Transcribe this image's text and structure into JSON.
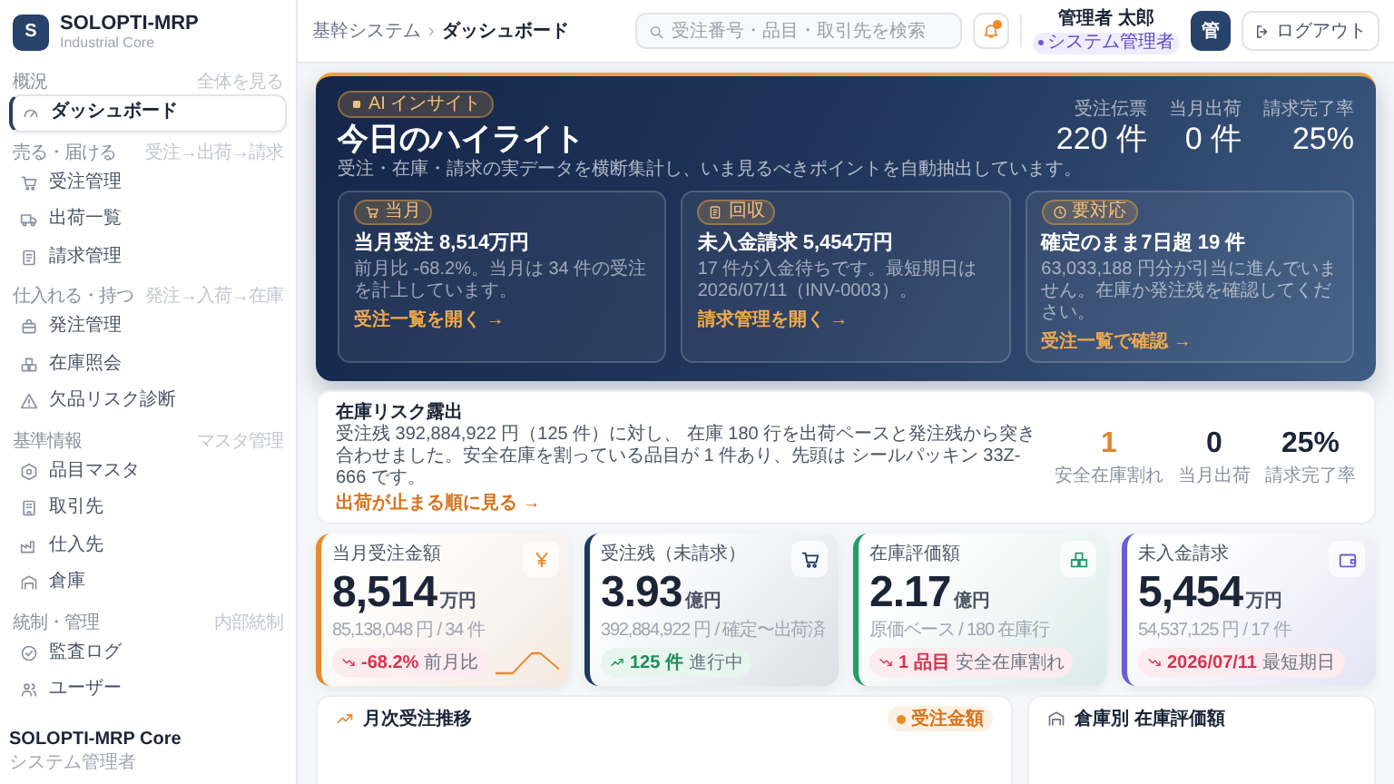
{
  "sidebar": {
    "brand": {
      "logo": "S",
      "name": "SOLOPTI-MRP",
      "subtitle": "Industrial Core"
    },
    "sections": [
      {
        "title": "概況",
        "hint": "全体を見る",
        "items": [
          {
            "label": "ダッシュボード",
            "selected": true
          }
        ]
      },
      {
        "title": "売る・届ける",
        "hint": "受注→出荷→請求",
        "items": [
          {
            "label": "受注管理",
            "selected": false
          },
          {
            "label": "出荷一覧",
            "selected": false
          },
          {
            "label": "請求管理",
            "selected": false
          }
        ]
      },
      {
        "title": "仕入れる・持つ",
        "hint": "発注→入荷→在庫",
        "items": [
          {
            "label": "発注管理",
            "selected": false
          },
          {
            "label": "在庫照会",
            "selected": false
          },
          {
            "label": "欠品リスク診断",
            "selected": false
          }
        ]
      },
      {
        "title": "基準情報",
        "hint": "マスタ管理",
        "items": [
          {
            "label": "品目マスタ",
            "selected": false
          },
          {
            "label": "取引先",
            "selected": false
          },
          {
            "label": "仕入先",
            "selected": false
          },
          {
            "label": "倉庫",
            "selected": false
          }
        ]
      },
      {
        "title": "統制・管理",
        "hint": "内部統制",
        "items": [
          {
            "label": "監査ログ",
            "selected": false
          },
          {
            "label": "ユーザー",
            "selected": false
          }
        ]
      }
    ],
    "footer": {
      "name": "SOLOPTI-MRP Core",
      "role": "システム管理者"
    }
  },
  "header": {
    "breadcrumb": [
      "基幹システム",
      "ダッシュボード"
    ],
    "separator": "›",
    "search": {
      "placeholder": "受注番号・品目・取引先を検索"
    },
    "notifications": {
      "unread": true
    },
    "user": {
      "name": "管理者 太郎",
      "role": "システム管理者",
      "avatar": "管"
    },
    "logout": "ログアウト"
  },
  "hero": {
    "badge": "AI インサイト",
    "title": "今日のハイライト",
    "subtitle": "受注・在庫・請求の実データを横断集計し、いま見るべきポイントを自動抽出しています。",
    "stats": [
      {
        "label": "受注伝票",
        "value": "220 件"
      },
      {
        "label": "当月出荷",
        "value": "0 件"
      },
      {
        "label": "請求完了率",
        "value": "25%"
      }
    ],
    "insights": [
      {
        "tag": "当月",
        "title": "当月受注 8,514万円",
        "body": "前月比 -68.2%。当月は 34 件の受注を計上しています。",
        "link": "受注一覧を開く →"
      },
      {
        "tag": "回収",
        "title": "未入金請求 5,454万円",
        "body": "17 件が入金待ちです。最短期日は 2026/07/11（INV-0003）。",
        "link": "請求管理を開く →"
      },
      {
        "tag": "要対応",
        "title": "確定のまま7日超 19 件",
        "body": "63,033,188 円分が引当に進んでいません。在庫か発注残を確認してください。",
        "link": "受注一覧で確認 →"
      }
    ]
  },
  "risk": {
    "title": "在庫リスク露出",
    "body": "受注残 392,884,922 円（125 件）に対し、 在庫 180 行を出荷ペースと発注残から突き合わせました。安全在庫を割っている品目が 1 件あり、先頭は シールパッキン 33Z-666 です。",
    "link": "出荷が止まる順に見る →",
    "stats": [
      {
        "value": "1",
        "label": "安全在庫割れ",
        "kind": "alert"
      },
      {
        "value": "0",
        "label": "当月出荷",
        "kind": "plain"
      },
      {
        "value": "25%",
        "label": "請求完了率",
        "kind": "plain"
      }
    ]
  },
  "kpis": [
    {
      "label": "当月受注金額",
      "value": "8,514",
      "unit": "万円",
      "sub": "85,138,048 円 / 34 件",
      "color": "#e8892b",
      "trend": {
        "kind": "down",
        "value": "-68.2%",
        "text": "前月比"
      },
      "sparkline": true
    },
    {
      "label": "受注残（未請求）",
      "value": "3.93",
      "unit": "億円",
      "sub": "392,884,922 円 / 確定〜出荷済",
      "color": "#1e3a5f",
      "trend": {
        "kind": "up",
        "value": "125 件",
        "text": "進行中"
      },
      "sparkline": false
    },
    {
      "label": "在庫評価額",
      "value": "2.17",
      "unit": "億円",
      "sub": "原価ベース / 180 在庫行",
      "color": "#1f9d6b",
      "trend": {
        "kind": "down",
        "value": "1 品目",
        "text": "安全在庫割れ"
      },
      "sparkline": false
    },
    {
      "label": "未入金請求",
      "value": "5,454",
      "unit": "万円",
      "sub": "54,537,125 円 / 17 件",
      "color": "#6b5bd6",
      "trend": {
        "kind": "down",
        "value": "2026/07/11",
        "text": "最短期日"
      },
      "sparkline": false
    }
  ],
  "panels": [
    {
      "title": "月次受注推移",
      "legend": {
        "label": "受注金額",
        "color": "#e8892b"
      }
    },
    {
      "title": "倉庫別 在庫評価額"
    }
  ]
}
